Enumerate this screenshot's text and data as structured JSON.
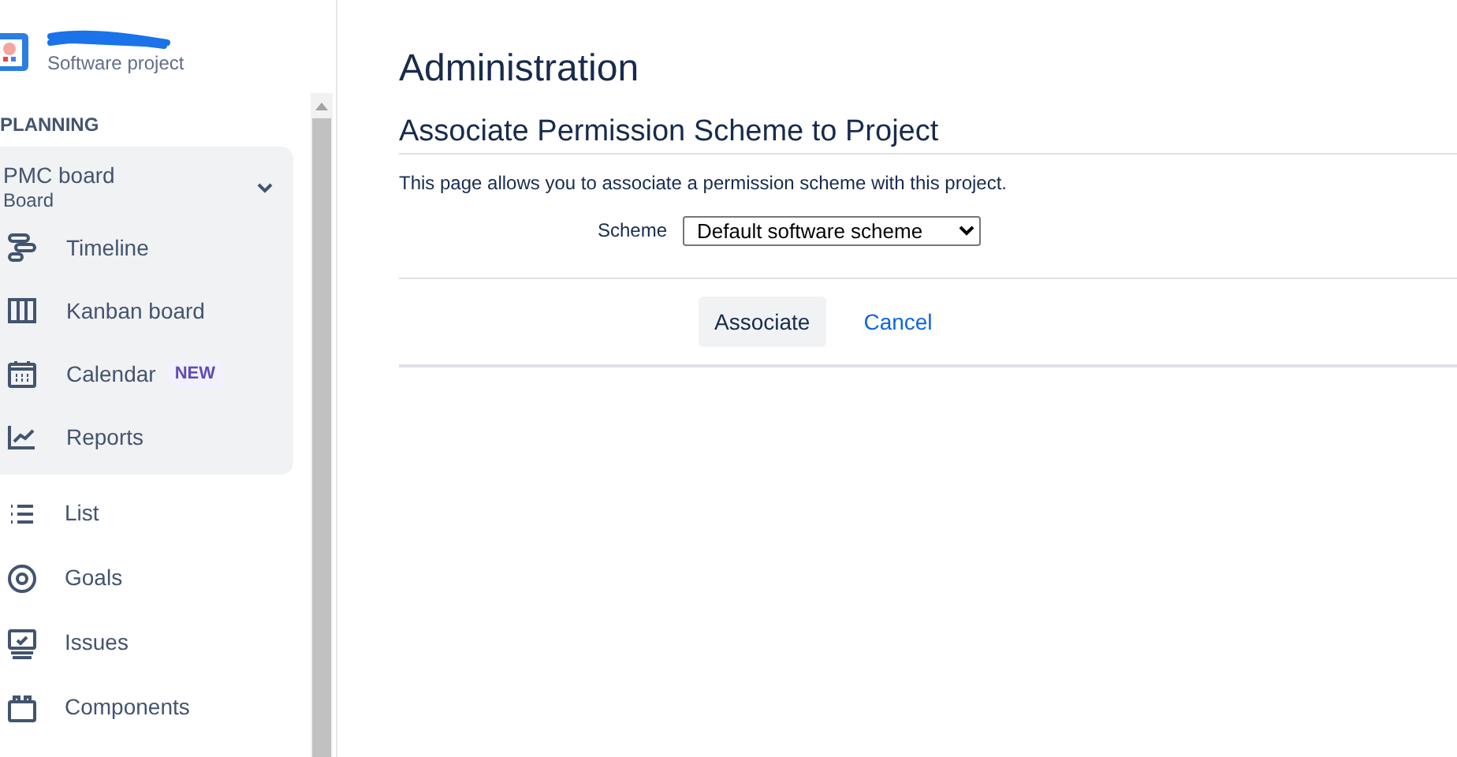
{
  "sidebar": {
    "project_type": "Software project",
    "section": "PLANNING",
    "board": {
      "name": "PMC board",
      "subtitle": "Board",
      "expanded": true,
      "items": [
        {
          "label": "Timeline"
        },
        {
          "label": "Kanban board"
        },
        {
          "label": "Calendar",
          "badge": "NEW"
        },
        {
          "label": "Reports"
        }
      ]
    },
    "items": [
      {
        "label": "List"
      },
      {
        "label": "Goals"
      },
      {
        "label": "Issues"
      },
      {
        "label": "Components"
      }
    ]
  },
  "page": {
    "title": "Administration",
    "subtitle": "Associate Permission Scheme to Project",
    "description": "This page allows you to associate a permission scheme with this project.",
    "scheme": {
      "label": "Scheme",
      "value": "Default software scheme"
    },
    "buttons": [
      {
        "label": "Associate",
        "kind": "primary"
      },
      {
        "label": "Cancel",
        "kind": "link"
      }
    ]
  }
}
